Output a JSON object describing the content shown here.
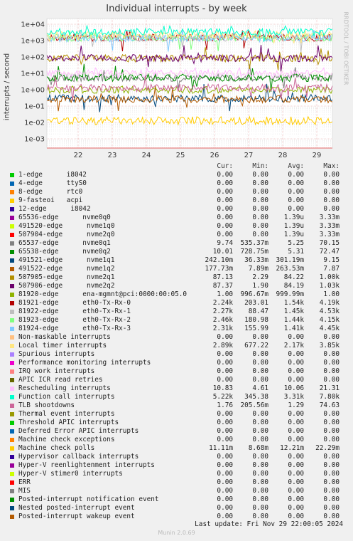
{
  "title": "Individual interrupts - by week",
  "watermark": "RRDTOOL / TOBI OETIKER",
  "footer": "Last update: Fri Nov 29 22:00:05 2024",
  "munin": "Munin 2.0.69",
  "legend_headers": {
    "cur": "Cur:",
    "min": "Min:",
    "avg": "Avg:",
    "max": "Max:"
  },
  "chart_data": {
    "type": "line",
    "title": "Individual interrupts - by week",
    "ylabel": "interrupts / second",
    "yscale": "log",
    "ylim": [
      0.0003,
      30000
    ],
    "yticks": [
      "1e-03",
      "1e-02",
      "1e-01",
      "1e+00",
      "1e+01",
      "1e+02",
      "1e+03",
      "1e+04"
    ],
    "xlabels": [
      "22",
      "23",
      "24",
      "25",
      "26",
      "27",
      "28",
      "29"
    ],
    "grid": true,
    "series": [
      {
        "name": "1-edge      i8042",
        "color": "#00cc00",
        "cur": "0.00",
        "min": "0.00",
        "avg": "0.00",
        "max": "0.00"
      },
      {
        "name": "4-edge      ttyS0",
        "color": "#0066b3",
        "cur": "0.00",
        "min": "0.00",
        "avg": "0.00",
        "max": "0.00"
      },
      {
        "name": "8-edge      rtc0",
        "color": "#ff8000",
        "cur": "0.00",
        "min": "0.00",
        "avg": "0.00",
        "max": "0.00"
      },
      {
        "name": "9-fasteoi   acpi",
        "color": "#ffcc00",
        "cur": "0.00",
        "min": "0.00",
        "avg": "0.00",
        "max": "0.00"
      },
      {
        "name": "12-edge      i8042",
        "color": "#330099",
        "cur": "0.00",
        "min": "0.00",
        "avg": "0.00",
        "max": "0.00"
      },
      {
        "name": "65536-edge      nvme0q0",
        "color": "#990099",
        "cur": "0.00",
        "min": "0.00",
        "avg": "1.39u",
        "max": "3.33m"
      },
      {
        "name": "491520-edge      nvme1q0",
        "color": "#ccff00",
        "cur": "0.00",
        "min": "0.00",
        "avg": "1.39u",
        "max": "3.33m"
      },
      {
        "name": "507904-edge      nvme2q0",
        "color": "#ff0000",
        "cur": "0.00",
        "min": "0.00",
        "avg": "1.39u",
        "max": "3.33m"
      },
      {
        "name": "65537-edge      nvme0q1",
        "color": "#808080",
        "cur": "9.74",
        "min": "535.37m",
        "avg": "5.25",
        "max": "70.15"
      },
      {
        "name": "65538-edge      nvme0q2",
        "color": "#008f00",
        "cur": "10.01",
        "min": "728.75m",
        "avg": "5.31",
        "max": "72.47"
      },
      {
        "name": "491521-edge      nvme1q1",
        "color": "#00487d",
        "cur": "242.10m",
        "min": "36.33m",
        "avg": "301.19m",
        "max": "9.15"
      },
      {
        "name": "491522-edge      nvme1q2",
        "color": "#b35a00",
        "cur": "177.73m",
        "min": "7.89m",
        "avg": "263.53m",
        "max": "7.87"
      },
      {
        "name": "507905-edge      nvme2q1",
        "color": "#b38f00",
        "cur": "87.13",
        "min": "2.29",
        "avg": "84.22",
        "max": "1.00k"
      },
      {
        "name": "507906-edge      nvme2q2",
        "color": "#6b006b",
        "cur": "87.37",
        "min": "1.90",
        "avg": "84.19",
        "max": "1.03k"
      },
      {
        "name": "81920-edge      ena-mgmnt@pci:0000:00:05.0",
        "color": "#8fb300",
        "cur": "1.00",
        "min": "996.67m",
        "avg": "999.99m",
        "max": "1.00"
      },
      {
        "name": "81921-edge      eth0-Tx-Rx-0",
        "color": "#b30000",
        "cur": "2.24k",
        "min": "203.01",
        "avg": "1.54k",
        "max": "4.19k"
      },
      {
        "name": "81922-edge      eth0-Tx-Rx-1",
        "color": "#bebebe",
        "cur": "2.27k",
        "min": "88.47",
        "avg": "1.45k",
        "max": "4.53k"
      },
      {
        "name": "81923-edge      eth0-Tx-Rx-2",
        "color": "#80ff80",
        "cur": "2.46k",
        "min": "180.98",
        "avg": "1.44k",
        "max": "4.15k"
      },
      {
        "name": "81924-edge      eth0-Tx-Rx-3",
        "color": "#80c9ff",
        "cur": "2.31k",
        "min": "155.99",
        "avg": "1.41k",
        "max": "4.45k"
      },
      {
        "name": "Non-maskable interrupts",
        "color": "#ffc080",
        "cur": "0.00",
        "min": "0.00",
        "avg": "0.00",
        "max": "0.00"
      },
      {
        "name": "Local timer interrupts",
        "color": "#ffe680",
        "cur": "2.89k",
        "min": "677.22",
        "avg": "2.17k",
        "max": "3.85k"
      },
      {
        "name": "Spurious interrupts",
        "color": "#aa80ff",
        "cur": "0.00",
        "min": "0.00",
        "avg": "0.00",
        "max": "0.00"
      },
      {
        "name": "Performance monitoring interrupts",
        "color": "#ee00cc",
        "cur": "0.00",
        "min": "0.00",
        "avg": "0.00",
        "max": "0.00"
      },
      {
        "name": "IRQ work interrupts",
        "color": "#ff8080",
        "cur": "0.00",
        "min": "0.00",
        "avg": "0.00",
        "max": "0.00"
      },
      {
        "name": "APIC ICR read retries",
        "color": "#666600",
        "cur": "0.00",
        "min": "0.00",
        "avg": "0.00",
        "max": "0.00"
      },
      {
        "name": "Rescheduling interrupts",
        "color": "#ffbfff",
        "cur": "10.83",
        "min": "4.61",
        "avg": "10.06",
        "max": "21.31"
      },
      {
        "name": "Function call interrupts",
        "color": "#00ffcc",
        "cur": "5.22k",
        "min": "345.38",
        "avg": "3.31k",
        "max": "7.80k"
      },
      {
        "name": "TLB shootdowns",
        "color": "#cc6699",
        "cur": "1.76",
        "min": "205.56m",
        "avg": "1.29",
        "max": "74.63"
      },
      {
        "name": "Thermal event interrupts",
        "color": "#999900",
        "cur": "0.00",
        "min": "0.00",
        "avg": "0.00",
        "max": "0.00"
      },
      {
        "name": "Threshold APIC interrupts",
        "color": "#00cc00",
        "cur": "0.00",
        "min": "0.00",
        "avg": "0.00",
        "max": "0.00"
      },
      {
        "name": "Deferred Error APIC interrupts",
        "color": "#0066b3",
        "cur": "0.00",
        "min": "0.00",
        "avg": "0.00",
        "max": "0.00"
      },
      {
        "name": "Machine check exceptions",
        "color": "#ff8000",
        "cur": "0.00",
        "min": "0.00",
        "avg": "0.00",
        "max": "0.00"
      },
      {
        "name": "Machine check polls",
        "color": "#ffcc00",
        "cur": "11.11m",
        "min": "8.68m",
        "avg": "12.21m",
        "max": "22.29m"
      },
      {
        "name": "Hypervisor callback interrupts",
        "color": "#330099",
        "cur": "0.00",
        "min": "0.00",
        "avg": "0.00",
        "max": "0.00"
      },
      {
        "name": "Hyper-V reenlightenment interrupts",
        "color": "#990099",
        "cur": "0.00",
        "min": "0.00",
        "avg": "0.00",
        "max": "0.00"
      },
      {
        "name": "Hyper-V stimer0 interrupts",
        "color": "#ccff00",
        "cur": "0.00",
        "min": "0.00",
        "avg": "0.00",
        "max": "0.00"
      },
      {
        "name": "ERR",
        "color": "#ff0000",
        "cur": "0.00",
        "min": "0.00",
        "avg": "0.00",
        "max": "0.00"
      },
      {
        "name": "MIS",
        "color": "#808080",
        "cur": "0.00",
        "min": "0.00",
        "avg": "0.00",
        "max": "0.00"
      },
      {
        "name": "Posted-interrupt notification event",
        "color": "#008f00",
        "cur": "0.00",
        "min": "0.00",
        "avg": "0.00",
        "max": "0.00"
      },
      {
        "name": "Nested posted-interrupt event",
        "color": "#00487d",
        "cur": "0.00",
        "min": "0.00",
        "avg": "0.00",
        "max": "0.00"
      },
      {
        "name": "Posted-interrupt wakeup event",
        "color": "#b35a00",
        "cur": "0.00",
        "min": "0.00",
        "avg": "0.00",
        "max": "0.00"
      }
    ]
  }
}
